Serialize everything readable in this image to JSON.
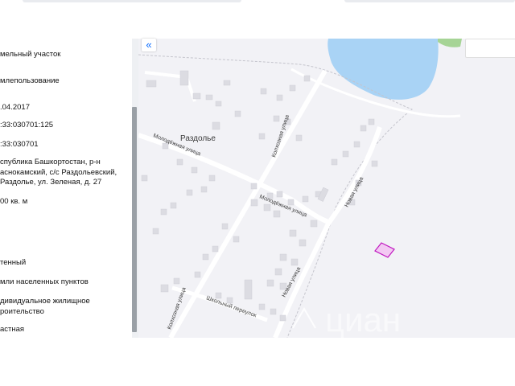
{
  "info": {
    "rows": [
      "мельный участок",
      "млепользование",
      ".04.2017",
      ":33:030701:125",
      ":33:030701",
      "спублика Башкортостан, р-н\nаснокамский, с/с Раздольевский,\nРаздолье, ул. Зеленая, д. 27",
      "00 кв. м",
      "тенный",
      "мли населенных пунктов",
      "дивидуальное жилищное\nроительство",
      "астная"
    ]
  },
  "map": {
    "collapse_label": "«",
    "search_placeholder": "",
    "labels": {
      "village": "Раздолье",
      "street_kolkhoznaya_1": "Колхозная улица",
      "street_kolkhoznaya_2": "Колхозная улица",
      "street_molodezhnaya_1": "Молодёжная улица",
      "street_molodezhnaya_2": "Молодёжная улица",
      "street_novaya_1": "Новая улица",
      "street_novaya_2": "Новая улица",
      "street_shkolny": "Школьный переулок"
    },
    "watermark": "циан",
    "colors": {
      "water": "#a9d3f5",
      "green": "#a6d496",
      "plot_fill": "#f3c9f3",
      "plot_stroke": "#c018c0"
    }
  }
}
